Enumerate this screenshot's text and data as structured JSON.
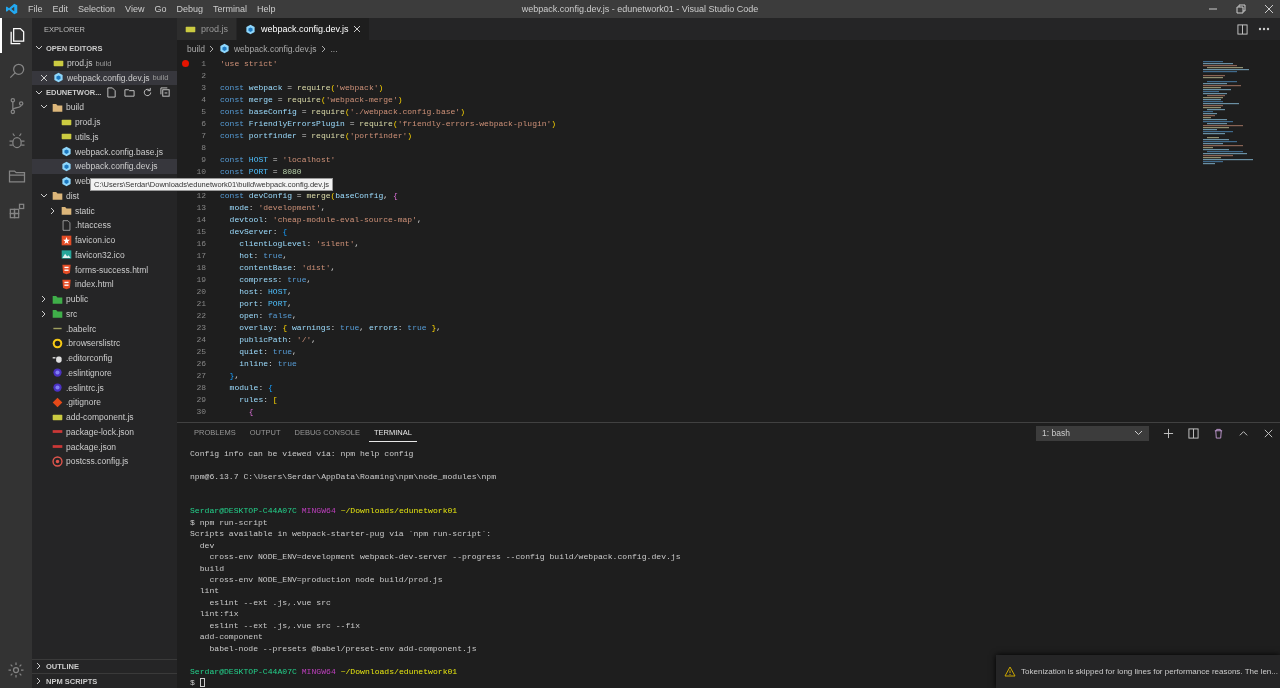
{
  "title_bar": {
    "menu": [
      "File",
      "Edit",
      "Selection",
      "View",
      "Go",
      "Debug",
      "Terminal",
      "Help"
    ],
    "title": "webpack.config.dev.js - edunetwork01 - Visual Studio Code"
  },
  "activity_bar": {
    "items": [
      {
        "kind": "files",
        "selected": true
      },
      {
        "kind": "search",
        "selected": false
      },
      {
        "kind": "source-control",
        "selected": false
      },
      {
        "kind": "debug",
        "selected": false
      },
      {
        "kind": "folder",
        "selected": false
      },
      {
        "kind": "extensions",
        "selected": false
      }
    ]
  },
  "sidebar": {
    "title": "EXPLORER",
    "open_editors": {
      "label": "OPEN EDITORS",
      "expanded": true,
      "items": [
        {
          "kind": "js",
          "name": "prod.js",
          "folder": "build",
          "selected": false,
          "close_button": false
        },
        {
          "kind": "webpack",
          "name": "webpack.config.dev.js",
          "folder": "build",
          "selected": true,
          "close_button": true
        }
      ]
    },
    "workspace": {
      "label": "EDUNETWOR...",
      "expanded": true,
      "tree": [
        {
          "kind": "folder",
          "name": "build",
          "expanded": true,
          "selected": false,
          "children": [
            {
              "kind": "js",
              "name": "prod.js",
              "selected": false
            },
            {
              "kind": "js",
              "name": "utils.js",
              "selected": false
            },
            {
              "kind": "webpack",
              "name": "webpack.config.base.js",
              "selected": false
            },
            {
              "kind": "webpack",
              "name": "webpack.config.dev.js",
              "selected": true
            },
            {
              "kind": "webpack",
              "name": "web",
              "selected": false
            }
          ]
        },
        {
          "kind": "folder",
          "name": "dist",
          "expanded": true,
          "selected": false,
          "children": [
            {
              "kind": "folder",
              "name": "static",
              "expanded": false,
              "selected": false
            },
            {
              "kind": "file",
              "name": ".htaccess",
              "selected": false
            },
            {
              "kind": "star",
              "name": "favicon.ico",
              "selected": false
            },
            {
              "kind": "image",
              "name": "favicon32.ico",
              "selected": false
            },
            {
              "kind": "html",
              "name": "forms-success.html",
              "selected": false
            },
            {
              "kind": "html",
              "name": "index.html",
              "selected": false
            }
          ]
        },
        {
          "kind": "folder-green",
          "name": "public",
          "expanded": false,
          "selected": false
        },
        {
          "kind": "folder-green",
          "name": "src",
          "expanded": false,
          "selected": false
        },
        {
          "kind": "babel",
          "name": ".babelrc",
          "selected": false
        },
        {
          "kind": "browserslist",
          "name": ".browserslistrc",
          "selected": false
        },
        {
          "kind": "editorconfig",
          "name": ".editorconfig",
          "selected": false
        },
        {
          "kind": "eslint",
          "name": ".eslintignore",
          "selected": false
        },
        {
          "kind": "eslint",
          "name": ".eslintrc.js",
          "selected": false
        },
        {
          "kind": "git",
          "name": ".gitignore",
          "selected": false
        },
        {
          "kind": "js",
          "name": "add-component.js",
          "selected": false
        },
        {
          "kind": "npm",
          "name": "package-lock.json",
          "selected": false
        },
        {
          "kind": "npm",
          "name": "package.json",
          "selected": false
        },
        {
          "kind": "postcss",
          "name": "postcss.config.js",
          "selected": false
        }
      ]
    },
    "sections": [
      {
        "label": "OUTLINE",
        "expanded": false
      },
      {
        "label": "NPM SCRIPTS",
        "expanded": false
      }
    ]
  },
  "tooltip": "C:\\Users\\Serdar\\Downloads\\edunetwork01\\build\\webpack.config.dev.js",
  "editor": {
    "tabs": [
      {
        "kind": "js",
        "label": "prod.js",
        "selected": false
      },
      {
        "kind": "webpack",
        "label": "webpack.config.dev.js",
        "selected": true
      }
    ],
    "breadcrumb": {
      "folder": "build",
      "kind": "webpack",
      "file": "webpack.config.dev.js",
      "symbol": "..."
    },
    "lines": [
      {
        "n": "1",
        "breakpoint": true,
        "text": "'use strict'"
      },
      {
        "n": "2",
        "breakpoint": false
      },
      {
        "n": "3",
        "breakpoint": false,
        "text": "const webpack = require('webpack')"
      },
      {
        "n": "4",
        "breakpoint": false,
        "text": "const merge = require('webpack-merge')"
      },
      {
        "n": "5",
        "breakpoint": false,
        "text": "const baseConfig = require('./webpack.config.base')"
      },
      {
        "n": "6",
        "breakpoint": false,
        "text": "const FriendlyErrorsPlugin = require('friendly-errors-webpack-plugin')"
      },
      {
        "n": "7",
        "breakpoint": false,
        "text": "const portfinder = require('portfinder')"
      },
      {
        "n": "8",
        "breakpoint": false
      },
      {
        "n": "9",
        "breakpoint": false,
        "text": "const HOST = 'localhost'"
      },
      {
        "n": "10",
        "breakpoint": false,
        "text": "const PORT = 8080"
      },
      {
        "breakpoint": false
      },
      {
        "n": "12",
        "breakpoint": false,
        "text": "const devConfig = merge(baseConfig, {"
      },
      {
        "n": "13",
        "breakpoint": false,
        "text": "  mode: 'development',"
      },
      {
        "n": "14",
        "breakpoint": false,
        "text": "  devtool: 'cheap-module-eval-source-map',"
      },
      {
        "n": "15",
        "breakpoint": false,
        "text": "  devServer: {"
      },
      {
        "n": "16",
        "breakpoint": false,
        "text": "    clientLogLevel: 'silent',"
      },
      {
        "n": "17",
        "breakpoint": false,
        "text": "    hot: true,"
      },
      {
        "n": "18",
        "breakpoint": false,
        "text": "    contentBase: 'dist',"
      },
      {
        "n": "19",
        "breakpoint": false,
        "text": "    compress: true,"
      },
      {
        "n": "20",
        "breakpoint": false,
        "text": "    host: HOST,"
      },
      {
        "n": "21",
        "breakpoint": false,
        "text": "    port: PORT,"
      },
      {
        "n": "22",
        "breakpoint": false,
        "text": "    open: false,"
      },
      {
        "n": "23",
        "breakpoint": false,
        "text": "    overlay: { warnings: true, errors: true },"
      },
      {
        "n": "24",
        "breakpoint": false,
        "text": "    publicPath: '/',"
      },
      {
        "n": "25",
        "breakpoint": false,
        "text": "    quiet: true,"
      },
      {
        "n": "26",
        "breakpoint": false,
        "text": "    inline: true"
      },
      {
        "n": "27",
        "breakpoint": false,
        "text": "  },"
      },
      {
        "n": "28",
        "breakpoint": false,
        "text": "  module: {"
      },
      {
        "n": "29",
        "breakpoint": false,
        "text": "    rules: ["
      },
      {
        "n": "30",
        "breakpoint": false,
        "text": "      {"
      }
    ]
  },
  "panel": {
    "tabs": [
      {
        "label": "PROBLEMS",
        "selected": false
      },
      {
        "label": "OUTPUT",
        "selected": false
      },
      {
        "label": "DEBUG CONSOLE",
        "selected": false
      },
      {
        "label": "TERMINAL",
        "selected": true
      }
    ],
    "terminal_select": "1: bash",
    "lines": [
      {
        "kind": "text",
        "text": "Config info can be viewed via: npm help config"
      },
      {
        "kind": "blank"
      },
      {
        "kind": "text",
        "text": "npm@6.13.7 C:\\Users\\Serdar\\AppData\\Roaming\\npm\\node_modules\\npm"
      },
      {
        "kind": "blank"
      },
      {
        "kind": "blank"
      },
      {
        "kind": "prompt",
        "user": "Serdar@DESKTOP-C44A07C",
        "env": "MINGW64",
        "path": "~/Downloads/edunetwork01"
      },
      {
        "kind": "text",
        "text": "$ npm run-script"
      },
      {
        "kind": "text",
        "text": "Scripts available in webpack-starter-pug via `npm run-script`:"
      },
      {
        "kind": "text",
        "text": "  dev"
      },
      {
        "kind": "text",
        "text": "    cross-env NODE_ENV=development webpack-dev-server --progress --config build/webpack.config.dev.js"
      },
      {
        "kind": "text",
        "text": "  build"
      },
      {
        "kind": "text",
        "text": "    cross-env NODE_ENV=production node build/prod.js"
      },
      {
        "kind": "text",
        "text": "  lint"
      },
      {
        "kind": "text",
        "text": "    eslint --ext .js,.vue src"
      },
      {
        "kind": "text",
        "text": "  lint:fix"
      },
      {
        "kind": "text",
        "text": "    eslint --ext .js,.vue src --fix"
      },
      {
        "kind": "text",
        "text": "  add-component"
      },
      {
        "kind": "text",
        "text": "    babel-node --presets @babel/preset-env add-component.js"
      },
      {
        "kind": "blank"
      },
      {
        "kind": "prompt",
        "user": "Serdar@DESKTOP-C44A07C",
        "env": "MINGW64",
        "path": "~/Downloads/edunetwork01"
      },
      {
        "kind": "input",
        "text": "$"
      }
    ]
  },
  "notification": {
    "kind": "warning",
    "text": "Tokenization is skipped for long lines for performance reasons. The len..."
  }
}
